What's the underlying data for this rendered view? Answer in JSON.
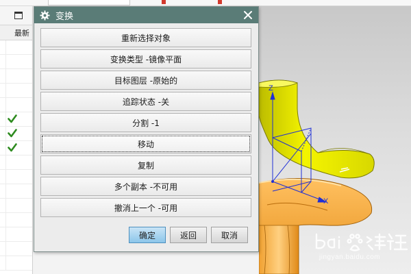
{
  "left_panel": {
    "column_header": "最新",
    "rows_checked": [
      false,
      false,
      false,
      false,
      false,
      true,
      true,
      true,
      false,
      false,
      false,
      false,
      false,
      false,
      false,
      false
    ]
  },
  "dialog": {
    "title": "变换",
    "menu_items": [
      "重新选择对象",
      "变换类型 -镜像平面",
      "目标图层 -原始的",
      "追踪状态 -关",
      "分割 -1",
      "移动",
      "复制",
      "多个副本 -不可用",
      "撤消上一个 -可用"
    ],
    "focused_index": 5,
    "buttons": {
      "ok": "确定",
      "back": "返回",
      "cancel": "取消"
    }
  },
  "viewport": {
    "axis_z_label": "Z",
    "axis_x_label": "X"
  },
  "watermark": {
    "url": "jingyan.baidu.com"
  },
  "colors": {
    "titlebar": "#5a7c77",
    "part_yellow": "#e8e800",
    "part_orange": "#f5a623",
    "axis_blue": "#1f2fd6",
    "check_green": "#2e8b1f"
  }
}
